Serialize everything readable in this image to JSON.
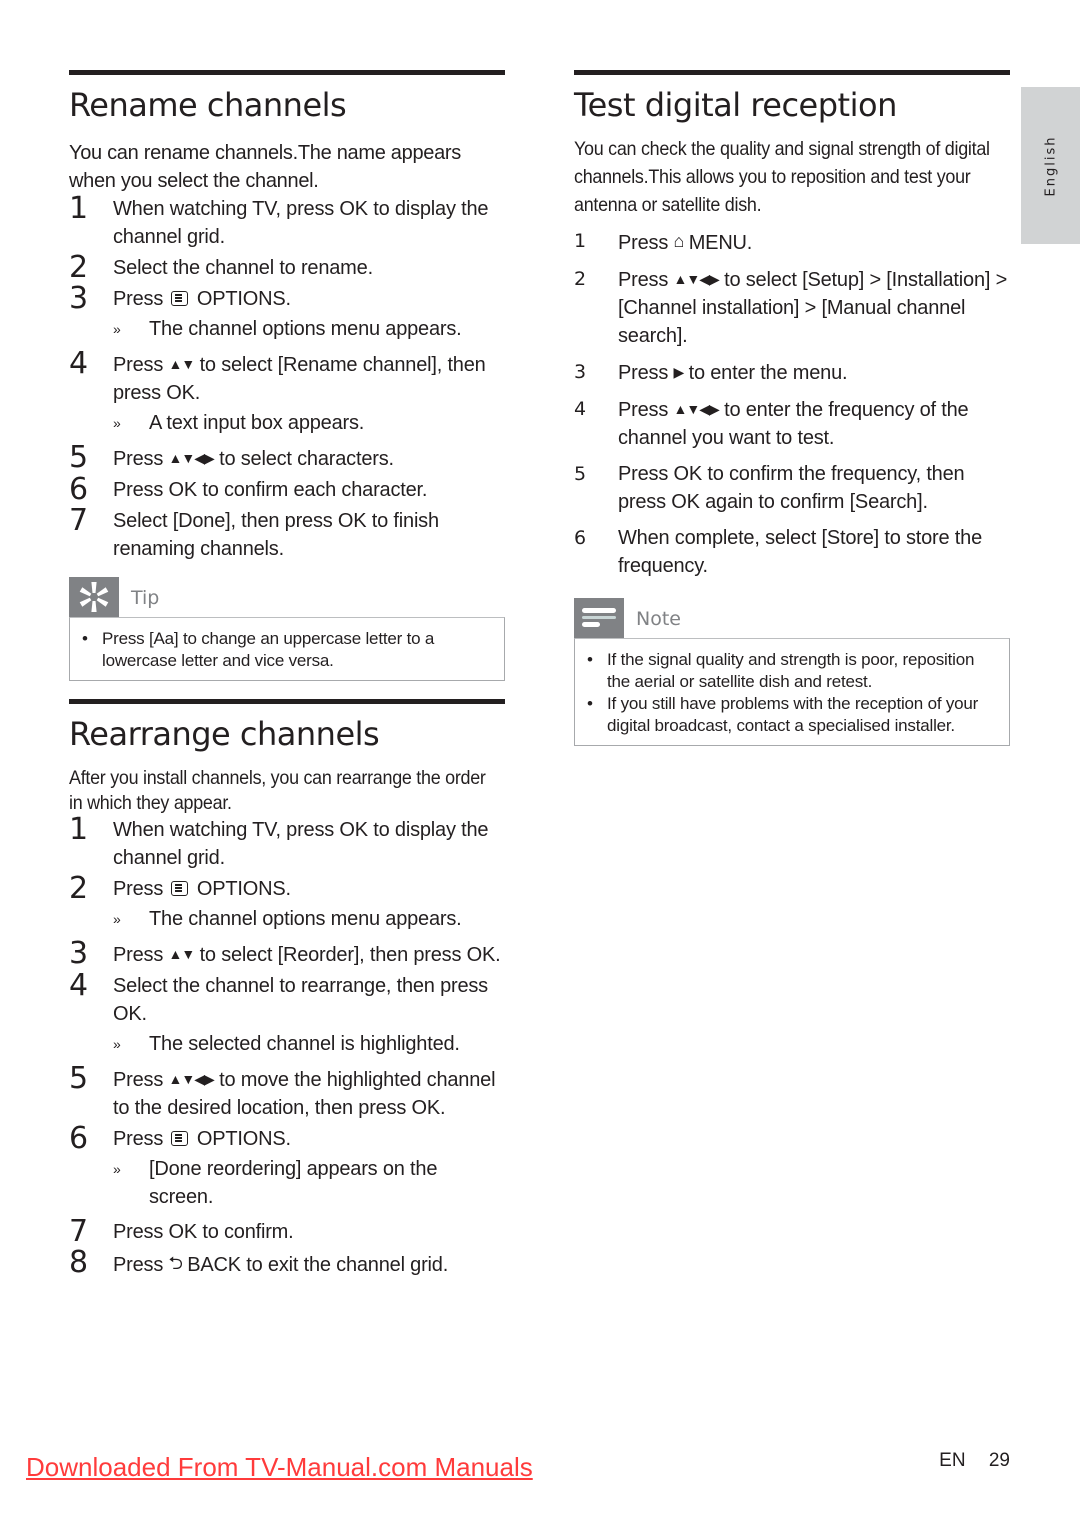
{
  "language_tab": "English",
  "left": {
    "rename": {
      "title": "Rename channels",
      "intro": "You can rename channels.The name appears when you select the channel.",
      "steps": [
        {
          "num": "1",
          "text": "When watching TV, press OK to display the channel grid."
        },
        {
          "num": "2",
          "text": "Select the channel to rename."
        },
        {
          "num": "3",
          "pre": "Press",
          "icon": "options-icon",
          "post": "OPTIONS.",
          "result": "The channel options menu appears."
        },
        {
          "num": "4",
          "pre": "Press",
          "arrows": "▲▼",
          "post": "to select [Rename channel], then press OK.",
          "result": "A text input box appears."
        },
        {
          "num": "5",
          "pre": "Press",
          "arrows": "▲▼◀▶",
          "post": "to select characters."
        },
        {
          "num": "6",
          "text": "Press OK to confirm each character."
        },
        {
          "num": "7",
          "text": "Select [Done], then press OK to finish renaming channels."
        }
      ],
      "tip": {
        "label": "Tip",
        "bullets": [
          "Press [Aa] to change an uppercase letter to a lowercase letter and vice versa."
        ]
      }
    },
    "rearrange": {
      "title": "Rearrange channels",
      "intro": "After you install channels, you can rearrange the order in which they appear.",
      "steps": [
        {
          "num": "1",
          "text": "When watching TV, press OK to display the channel grid."
        },
        {
          "num": "2",
          "pre": "Press",
          "icon": "options-icon",
          "post": "OPTIONS.",
          "result": "The channel options menu appears."
        },
        {
          "num": "3",
          "pre": "Press",
          "arrows": "▲▼",
          "post": "to select [Reorder], then press OK."
        },
        {
          "num": "4",
          "text": "Select the channel to rearrange, then press OK.",
          "result": "The selected channel is highlighted."
        },
        {
          "num": "5",
          "pre": "Press",
          "arrows": "▲▼◀▶",
          "post": "to move the highlighted channel to the desired location, then press OK."
        },
        {
          "num": "6",
          "pre": "Press",
          "icon": "options-icon",
          "post": "OPTIONS.",
          "result": "[Done reordering] appears on the screen."
        },
        {
          "num": "7",
          "text": "Press OK to confirm."
        },
        {
          "num": "8",
          "pre": "Press",
          "back": "⮌",
          "post": "BACK to exit the channel grid."
        }
      ]
    }
  },
  "right": {
    "test": {
      "title": "Test digital reception",
      "intro": "You can check the quality and signal strength of digital channels.This allows you to reposition and test your antenna or satellite dish.",
      "steps": [
        {
          "num": "1",
          "pre": "Press",
          "home": "⌂",
          "post": "MENU."
        },
        {
          "num": "2",
          "pre": "Press",
          "arrows": "▲▼◀▶",
          "post": "to select [Setup] > [Installation] > [Channel installation] > [Manual channel search]."
        },
        {
          "num": "3",
          "pre": "Press",
          "arrows": "▶",
          "post": "to enter the menu."
        },
        {
          "num": "4",
          "pre": "Press",
          "arrows": "▲▼◀▶",
          "post": "to enter the frequency of the channel you want to test."
        },
        {
          "num": "5",
          "text": "Press OK to confirm the frequency, then press OK again to confirm [Search]."
        },
        {
          "num": "6",
          "text": "When complete, select [Store] to store the frequency."
        }
      ],
      "note": {
        "label": "Note",
        "bullets": [
          "If the signal quality and strength is poor, reposition the aerial or satellite dish and retest.",
          "If you still have problems with the reception of your digital broadcast, contact a specialised installer."
        ]
      }
    }
  },
  "footer": {
    "download_link": "Downloaded From TV-Manual.com Manuals",
    "lang_code": "EN",
    "page_number": "29"
  },
  "result_marker": "»"
}
